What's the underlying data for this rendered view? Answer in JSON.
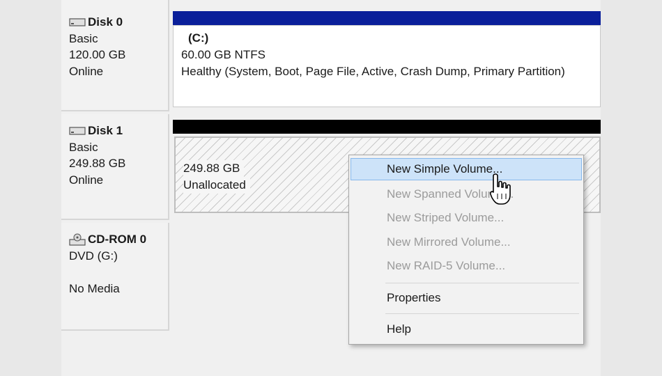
{
  "disks": [
    {
      "name": "Disk 0",
      "type": "Basic",
      "size": "120.00 GB",
      "status": "Online"
    },
    {
      "name": "Disk 1",
      "type": "Basic",
      "size": "249.88 GB",
      "status": "Online"
    },
    {
      "name": "CD-ROM 0",
      "type": "DVD (G:)",
      "status": "No Media"
    }
  ],
  "volumes": {
    "c": {
      "name": "(C:)",
      "size_fs": "60.00 GB NTFS",
      "status": "Healthy (System, Boot, Page File, Active, Crash Dump, Primary Partition)",
      "bar_color": "#0a1f9a"
    },
    "unallocated": {
      "size": "249.88 GB",
      "label": "Unallocated",
      "bar_color": "#000000"
    }
  },
  "context_menu": {
    "items": [
      {
        "label": "New Simple Volume...",
        "enabled": true,
        "highlighted": true
      },
      {
        "label": "New Spanned Volume...",
        "enabled": false
      },
      {
        "label": "New Striped Volume...",
        "enabled": false
      },
      {
        "label": "New Mirrored Volume...",
        "enabled": false
      },
      {
        "label": "New RAID-5 Volume...",
        "enabled": false
      },
      {
        "label": "Properties",
        "enabled": true
      },
      {
        "label": "Help",
        "enabled": true
      }
    ]
  },
  "colors": {
    "hover_bg": "#cde3f9",
    "hover_border": "#86b8ec",
    "disabled_text": "#9b9b9b"
  }
}
